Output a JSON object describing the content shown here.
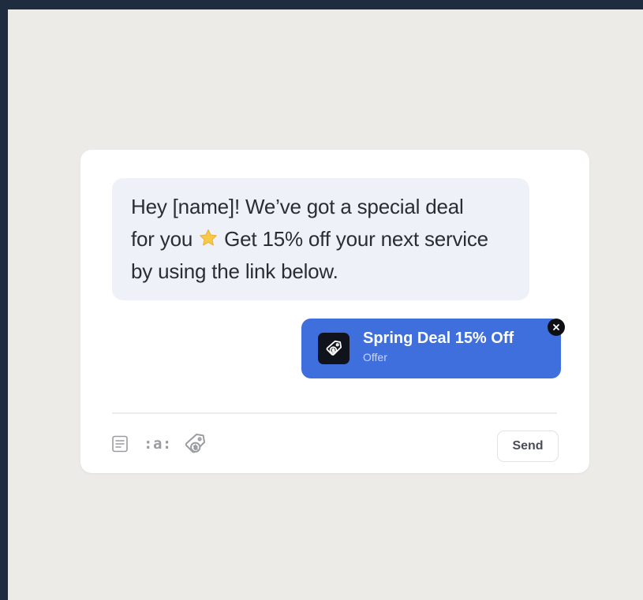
{
  "message": {
    "text_before_emoji": "Hey [name]! We’ve got a special deal\nfor you ",
    "emoji_icon": "star-icon",
    "text_after_emoji": " Get 15% off your next service\nby using the link below."
  },
  "offer": {
    "title": "Spring Deal 15% Off",
    "subtitle": "Offer",
    "icon": "offer-tag-icon",
    "remove_icon": "close-icon"
  },
  "toolbar": {
    "template_icon": "template-icon",
    "emoji_label": ":a:",
    "offer_icon": "offer-tag-icon",
    "send_label": "Send"
  },
  "colors": {
    "offer_background": "#3f6fdc",
    "message_background": "#eef1f8",
    "page_background": "#edebe8",
    "frame": "#1f2c3f"
  }
}
